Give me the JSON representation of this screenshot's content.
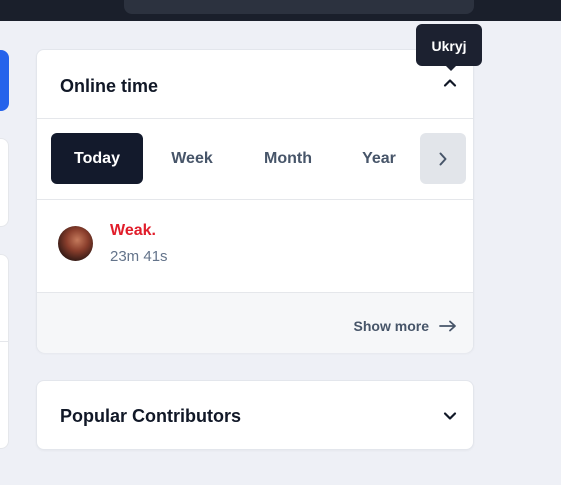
{
  "online_time": {
    "title": "Online time",
    "tooltip": "Ukryj",
    "collapse_icon": "chevron-up-icon",
    "tabs": [
      {
        "label": "Today",
        "active": true
      },
      {
        "label": "Week",
        "active": false
      },
      {
        "label": "Month",
        "active": false
      },
      {
        "label": "Year",
        "active": false
      }
    ],
    "scroll_icon": "chevron-right-icon",
    "users": [
      {
        "name": "Weak.",
        "time": "23m 41s"
      }
    ],
    "show_more": {
      "label": "Show more",
      "icon": "arrow-right-icon"
    }
  },
  "popular_contributors": {
    "title": "Popular Contributors",
    "expand_icon": "chevron-down-icon"
  },
  "colors": {
    "active_tab": "#131a2c",
    "username": "#e11d2a",
    "accent_blue": "#2563eb",
    "topbar": "#1a1f2b"
  }
}
